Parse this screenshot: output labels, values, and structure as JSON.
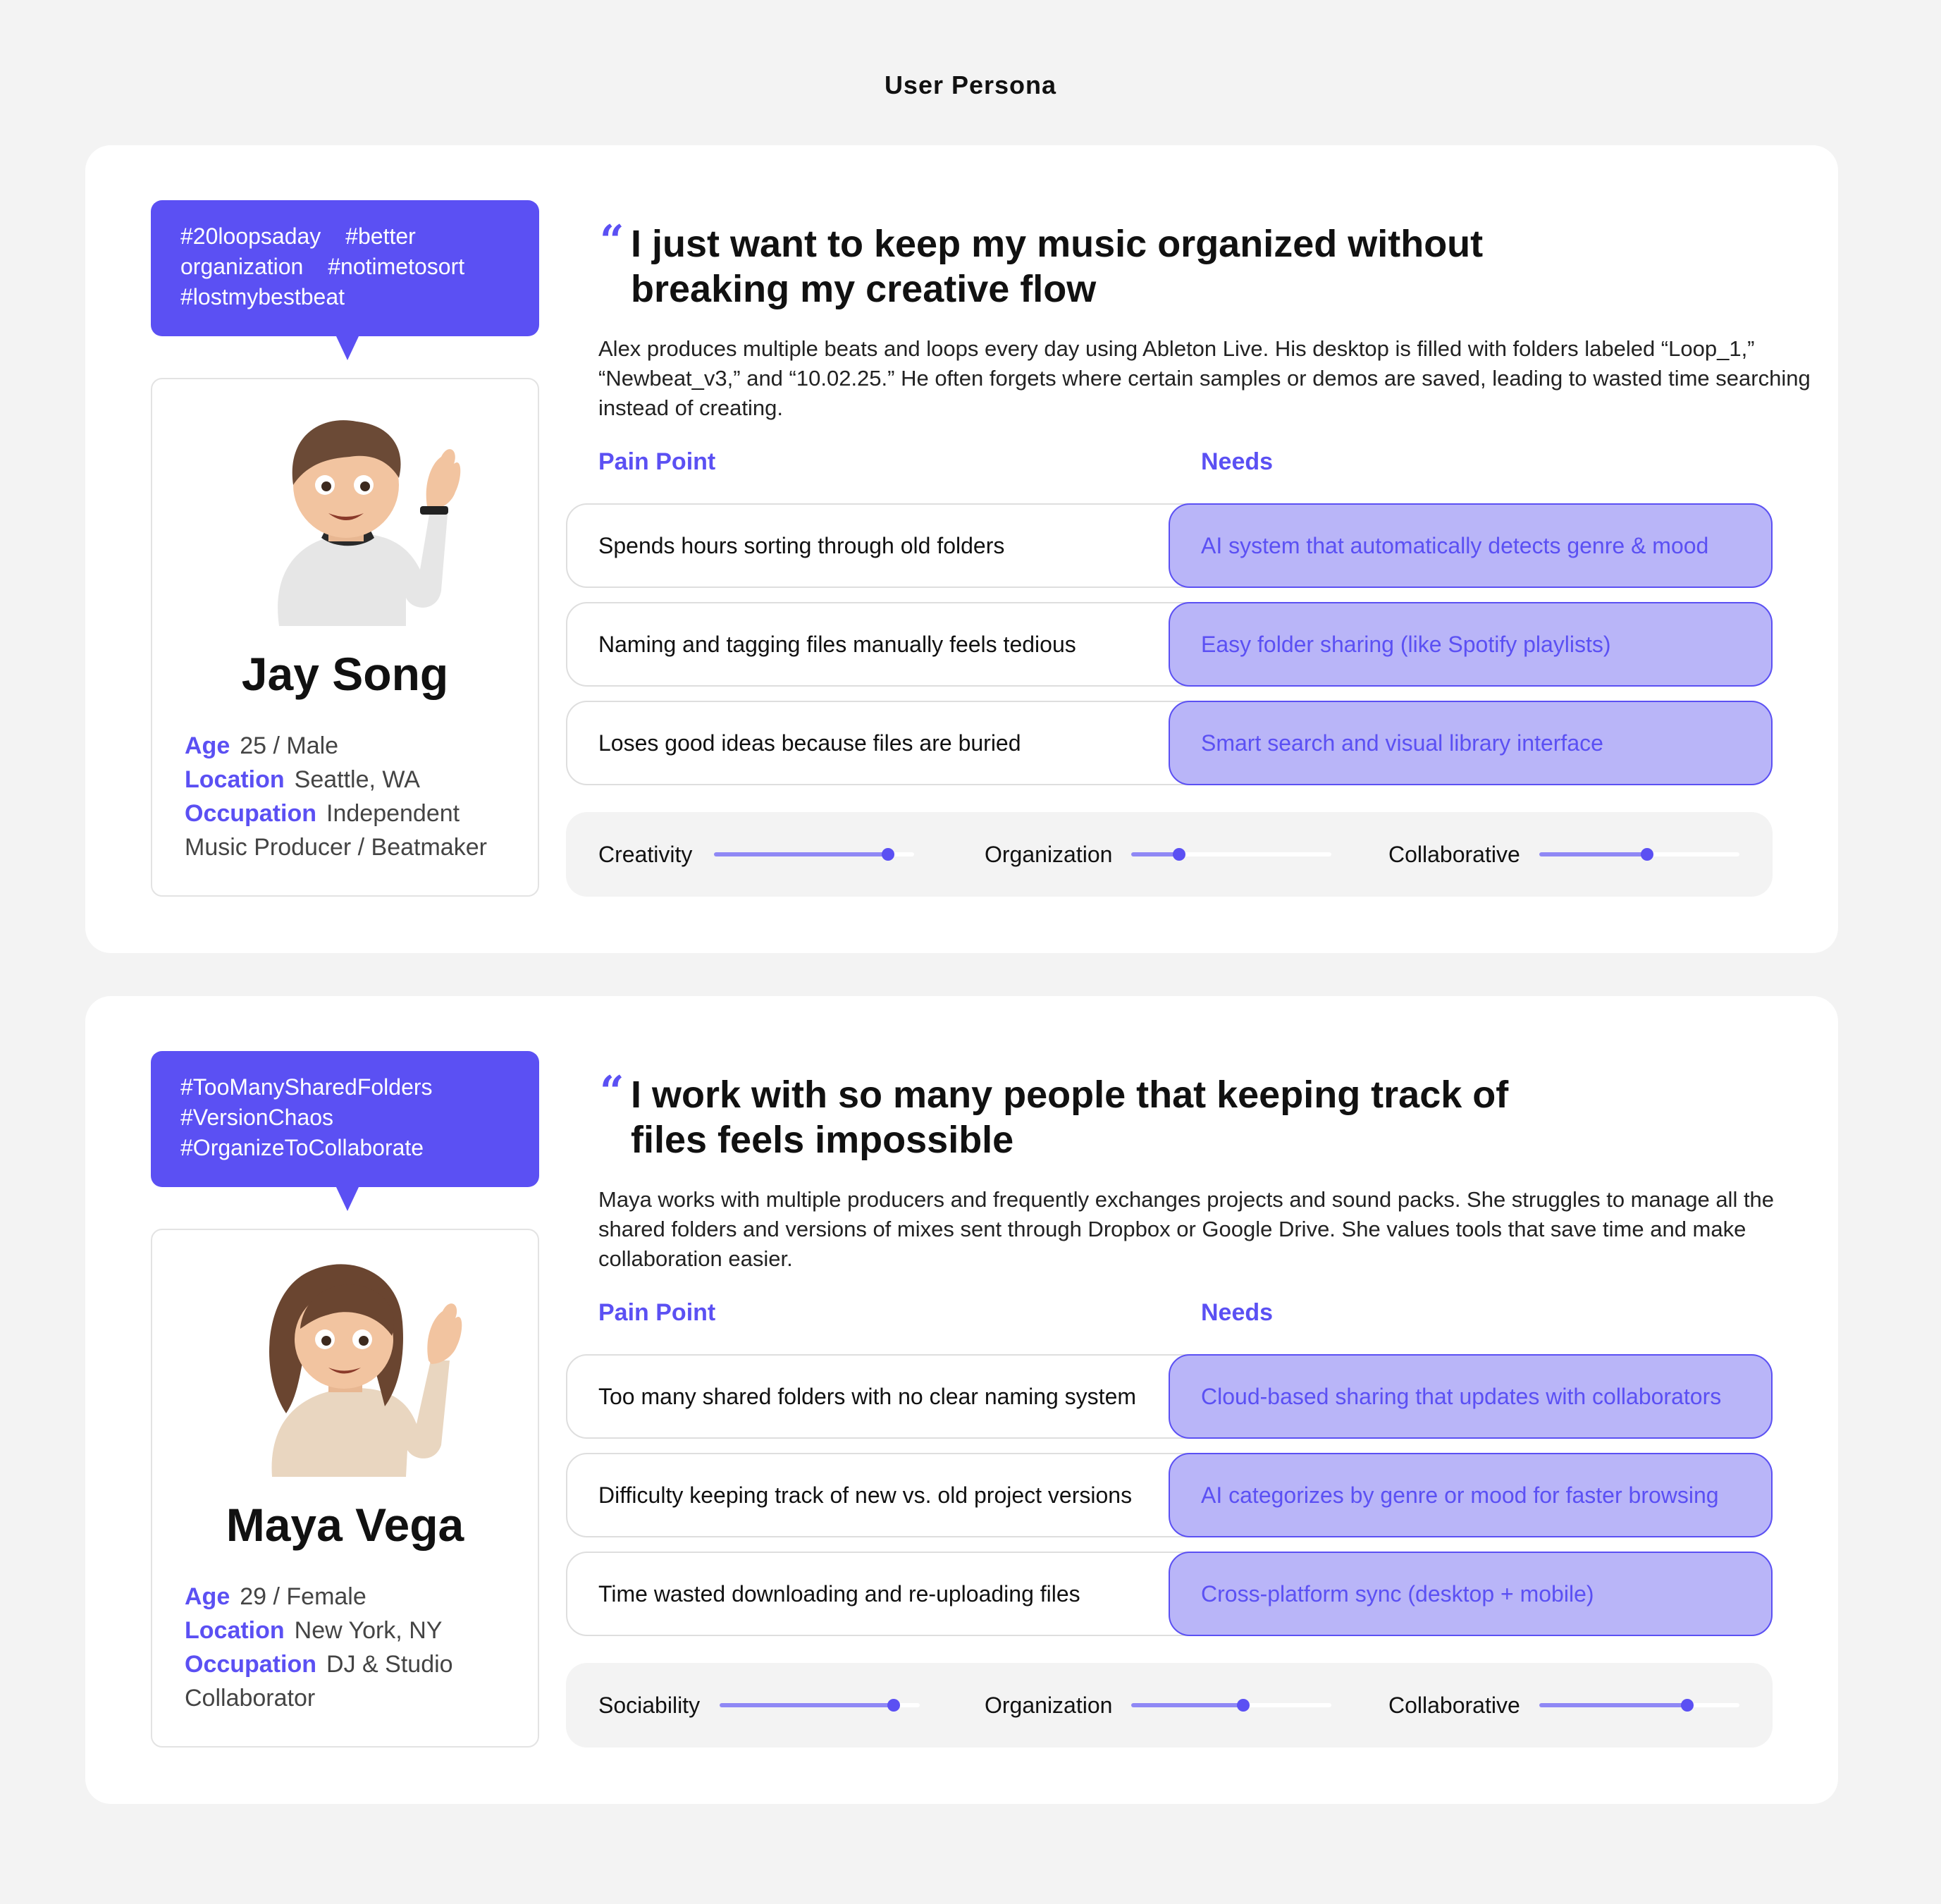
{
  "page_title": "User Persona",
  "colors": {
    "accent": "#5b50f3",
    "needs_fill": "#b9b5f8",
    "track_fill": "#8f88f5",
    "background": "#f3f3f3"
  },
  "personas": [
    {
      "tags": [
        "#20loopsaday",
        "#better organization",
        "#notimetosort",
        "#lostmybestbeat"
      ],
      "avatar_icon": "memoji-boy-waving-icon",
      "name": "Jay Song",
      "info": {
        "age_label": "Age",
        "age": "25 / Male",
        "location_label": "Location",
        "location": "Seattle, WA",
        "occupation_label": "Occupation",
        "occupation": "Independent Music Producer / Beatmaker"
      },
      "quote": "I just want to keep my music organized without breaking my creative flow",
      "description": "Alex produces multiple beats and loops every day using Ableton Live. His desktop is filled with folders labeled “Loop_1,” “Newbeat_v3,” and “10.02.25.” He often forgets where certain samples or demos are saved, leading to wasted time searching instead of creating.",
      "pain_header": "Pain Point",
      "needs_header": "Needs",
      "rows": [
        {
          "pain": "Spends hours sorting through old folders",
          "need": "AI system that automatically detects genre & mood"
        },
        {
          "pain": "Naming and tagging files manually feels tedious",
          "need": "Easy folder sharing (like Spotify playlists)"
        },
        {
          "pain": "Loses good ideas because files are buried",
          "need": "Smart search and visual library interface"
        }
      ],
      "traits": [
        {
          "label": "Creativity",
          "level": 0.87
        },
        {
          "label": "Organization",
          "level": 0.24
        },
        {
          "label": "Collaborative",
          "level": 0.54
        }
      ]
    },
    {
      "tags": [
        "#TooManySharedFolders",
        "#VersionChaos",
        "#OrganizeToCollaborate"
      ],
      "avatar_icon": "memoji-girl-waving-icon",
      "name": "Maya Vega",
      "info": {
        "age_label": "Age",
        "age": "29 / Female",
        "location_label": "Location",
        "location": "New York, NY",
        "occupation_label": "Occupation",
        "occupation": "DJ & Studio Collaborator"
      },
      "quote": "I work with so many people that keeping track of files feels impossible",
      "description": "Maya works with multiple producers and frequently exchanges projects and sound packs. She struggles to manage all the shared folders and versions of mixes sent through Dropbox or Google Drive. She values tools that save time and make collaboration easier.",
      "pain_header": "Pain Point",
      "needs_header": "Needs",
      "rows": [
        {
          "pain": "Too many shared folders with no clear naming system",
          "need": "Cloud-based sharing that updates with collaborators"
        },
        {
          "pain": "Difficulty keeping track of new vs. old project versions",
          "need": "AI categorizes by genre or mood for faster browsing"
        },
        {
          "pain": "Time wasted downloading and re-uploading files",
          "need": "Cross-platform sync (desktop + mobile)"
        }
      ],
      "traits": [
        {
          "label": "Sociability",
          "level": 0.87
        },
        {
          "label": "Organization",
          "level": 0.56
        },
        {
          "label": "Collaborative",
          "level": 0.74
        }
      ]
    }
  ]
}
